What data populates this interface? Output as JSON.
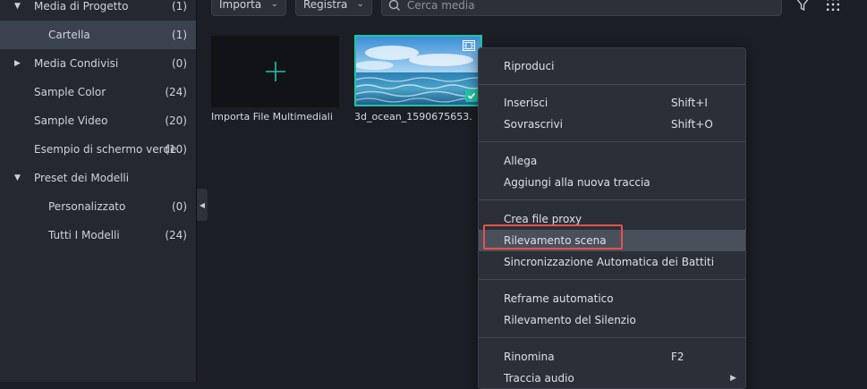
{
  "sidebar": {
    "items": [
      {
        "label": "Media di Progetto",
        "count": "(1)",
        "arrow": "▼"
      },
      {
        "label": "Cartella",
        "count": "(1)",
        "arrow": ""
      },
      {
        "label": "Media Condivisi",
        "count": "(0)",
        "arrow": "▶"
      },
      {
        "label": "Sample Color",
        "count": "(24)",
        "arrow": ""
      },
      {
        "label": "Sample Video",
        "count": "(20)",
        "arrow": ""
      },
      {
        "label": "Esempio di schermo verde",
        "count": "(10)",
        "arrow": ""
      },
      {
        "label": "Preset dei Modelli",
        "count": "",
        "arrow": "▼"
      },
      {
        "label": "Personalizzato",
        "count": "(0)",
        "arrow": ""
      },
      {
        "label": "Tutti I Modelli",
        "count": "(24)",
        "arrow": ""
      }
    ],
    "collapse_icon": "◀"
  },
  "toolbar": {
    "import_label": "Importa",
    "record_label": "Registra",
    "chevron": "⌄",
    "search_placeholder": "Cerca media",
    "filter_icon": "filter-icon",
    "grid_icon": "grid-icon"
  },
  "media": {
    "import_caption": "Importa File Multimediali",
    "clip_caption": "3d_ocean_1590675653."
  },
  "context_menu": {
    "items": [
      {
        "label": "Riproduci",
        "shortcut": ""
      },
      {
        "label": "Inserisci",
        "shortcut": "Shift+I"
      },
      {
        "label": "Sovrascrivi",
        "shortcut": "Shift+O"
      },
      {
        "label": "Allega",
        "shortcut": ""
      },
      {
        "label": "Aggiungi alla nuova traccia",
        "shortcut": ""
      },
      {
        "label": "Crea file proxy",
        "shortcut": ""
      },
      {
        "label": "Rilevamento scena",
        "shortcut": ""
      },
      {
        "label": "Sincronizzazione Automatica dei Battiti",
        "shortcut": ""
      },
      {
        "label": "Reframe automatico",
        "shortcut": ""
      },
      {
        "label": "Rilevamento del Silenzio",
        "shortcut": ""
      },
      {
        "label": "Rinomina",
        "shortcut": "F2"
      },
      {
        "label": "Traccia audio",
        "shortcut": "",
        "submenu": "▶"
      }
    ]
  },
  "colors": {
    "accent": "#22c3a5",
    "highlight_border": "#e5534b",
    "menu_hover": "#4a505b"
  }
}
